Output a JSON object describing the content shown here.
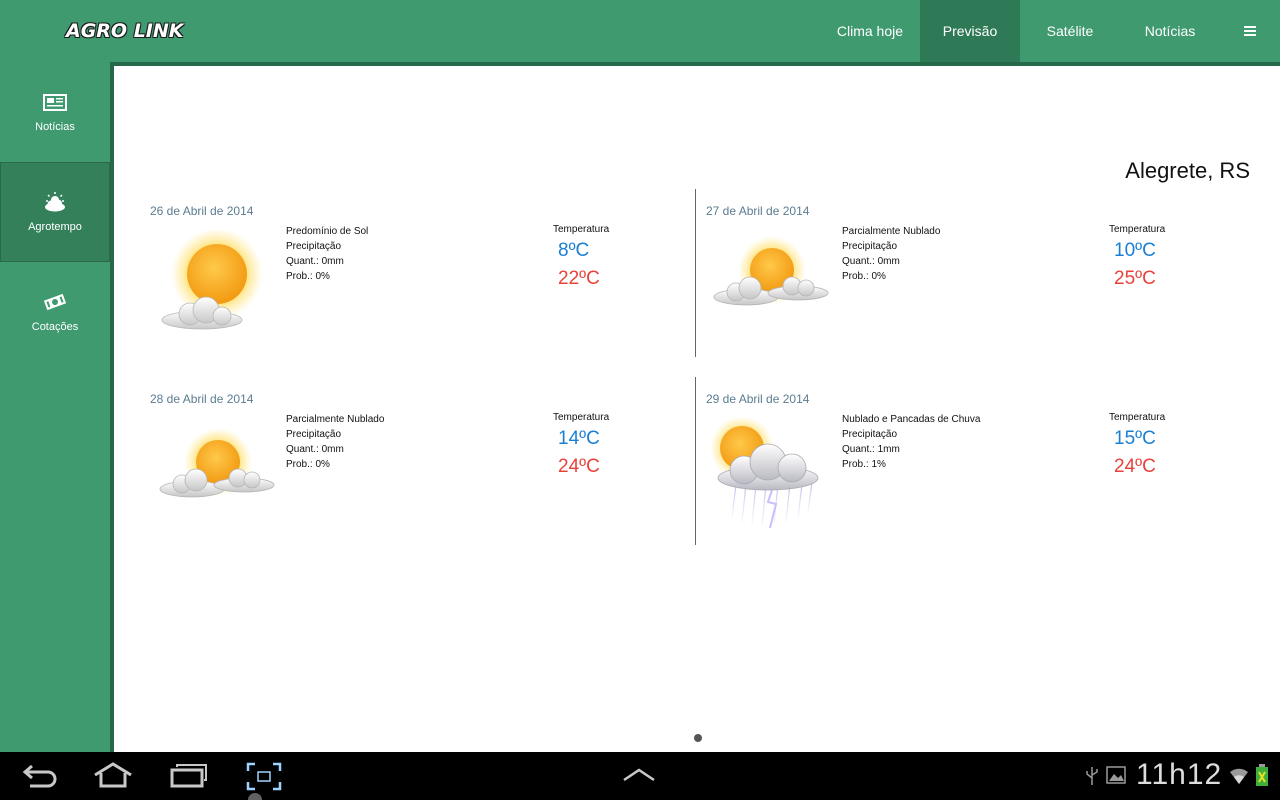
{
  "app": {
    "logo_text": "AGRO LINK"
  },
  "nav": {
    "items": [
      {
        "label": "Clima hoje"
      },
      {
        "label": "Previsão"
      },
      {
        "label": "Satélite"
      },
      {
        "label": "Notícias"
      }
    ],
    "menu_icon": "hamburger-icon"
  },
  "sidebar": {
    "items": [
      {
        "label": "Notícias",
        "icon": "newspaper-icon"
      },
      {
        "label": "Agrotempo",
        "icon": "cloud-sun-icon"
      },
      {
        "label": "Cotações",
        "icon": "money-icon"
      }
    ]
  },
  "forecast": {
    "location": "Alegrete, RS",
    "days": [
      {
        "date": "26 de Abril de 2014",
        "condition": "Predomínio de Sol",
        "precip_label": "Precipitação",
        "quant": "Quant.: 0mm",
        "prob": "Prob.: 0%",
        "temp_label": "Temperatura",
        "min": "8ºC",
        "max": "22ºC",
        "icon": "sun-icon"
      },
      {
        "date": "27 de Abril de 2014",
        "condition": "Parcialmente Nublado",
        "precip_label": "Precipitação",
        "quant": "Quant.: 0mm",
        "prob": "Prob.: 0%",
        "temp_label": "Temperatura",
        "min": "10ºC",
        "max": "25ºC",
        "icon": "partly-cloudy-icon"
      },
      {
        "date": "28 de Abril de 2014",
        "condition": "Parcialmente Nublado",
        "precip_label": "Precipitação",
        "quant": "Quant.: 0mm",
        "prob": "Prob.: 0%",
        "temp_label": "Temperatura",
        "min": "14ºC",
        "max": "24ºC",
        "icon": "partly-cloudy-icon"
      },
      {
        "date": "29 de Abril de 2014",
        "condition": "Nublado e Pancadas de Chuva",
        "precip_label": "Precipitação",
        "quant": "Quant.: 1mm",
        "prob": "Prob.: 1%",
        "temp_label": "Temperatura",
        "min": "15ºC",
        "max": "24ºC",
        "icon": "thunderstorm-icon"
      }
    ]
  },
  "system_bar": {
    "time": "11h12"
  },
  "colors": {
    "brand_green": "#3f9a70",
    "active_green": "#2f7a56",
    "temp_min": "#1a7fd3",
    "temp_max": "#e8423a"
  }
}
